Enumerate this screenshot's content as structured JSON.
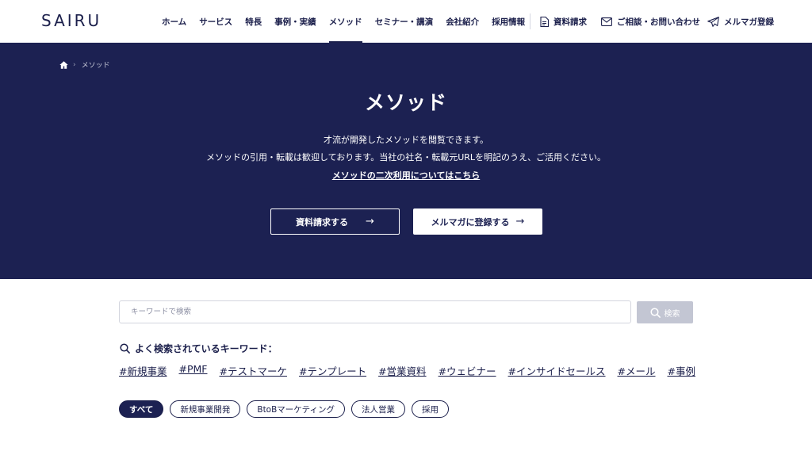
{
  "header": {
    "logo": "SAIRU",
    "nav": [
      {
        "label": "ホーム"
      },
      {
        "label": "サービス"
      },
      {
        "label": "特長"
      },
      {
        "label": "事例・実績"
      },
      {
        "label": "メソッド"
      },
      {
        "label": "セミナー・講演"
      },
      {
        "label": "会社紹介"
      },
      {
        "label": "採用情報"
      }
    ],
    "active_nav": "メソッド",
    "docs_request": "資料請求",
    "contact": "ご相談・お問い合わせ",
    "newsletter": "メルマガ登録"
  },
  "breadcrumb": {
    "current": "メソッド"
  },
  "hero": {
    "title": "メソッド",
    "desc_line1": "才流が開発したメソッドを閲覧できます。",
    "desc_line2": "メソッドの引用・転載は歓迎しております。当社の社名・転載元URLを明記のうえ、ご活用ください。",
    "secondary_use_link": "メソッドの二次利用についてはこちら",
    "btn_docs": "資料請求する",
    "btn_newsletter": "メルマガに登録する",
    "arrow": "→"
  },
  "search": {
    "placeholder": "キーワードで検索",
    "button": "検索"
  },
  "keywords": {
    "title": "よく検索されているキーワード：",
    "items": [
      "#新規事業",
      "#PMF",
      "#テストマーケ",
      "#テンプレート",
      "#営業資料",
      "#ウェビナー",
      "#インサイドセールス",
      "#メール",
      "#事例"
    ]
  },
  "categories": {
    "items": [
      "すべて",
      "新規事業開発",
      "BtoBマーケティング",
      "法人営業",
      "採用"
    ],
    "selected": "すべて"
  },
  "colors": {
    "navy": "#1c2152",
    "text": "#1b1f4b",
    "search_button": "#c3c6d3"
  }
}
